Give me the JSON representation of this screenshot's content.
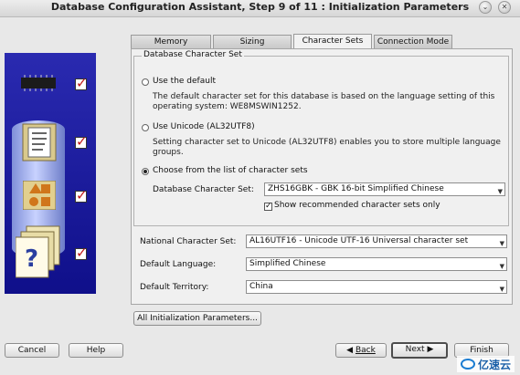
{
  "window": {
    "title": "Database Configuration Assistant, Step 9 of 11 : Initialization Parameters",
    "minimize_icon": "chevron-down-icon",
    "close_icon": "close-icon"
  },
  "tabs": [
    {
      "label": "Memory"
    },
    {
      "label": "Sizing"
    },
    {
      "label": "Character Sets",
      "active": true
    },
    {
      "label": "Connection Mode"
    }
  ],
  "charset_group": {
    "title": "Database Character Set",
    "use_default": {
      "label": "Use the default",
      "description_line1": "The default character set for this database is based on the language setting of this",
      "description_line2": "operating system: WE8MSWIN1252."
    },
    "use_unicode": {
      "label": "Use Unicode (AL32UTF8)",
      "description_line1": "Setting character set to Unicode (AL32UTF8) enables you to store multiple language",
      "description_line2": "groups."
    },
    "choose_list": {
      "label": "Choose from the list of character sets",
      "selected": true
    },
    "db_charset_label": "Database Character Set:",
    "db_charset_value": "ZHS16GBK - GBK 16-bit Simplified Chinese",
    "show_recommended_label": "Show recommended character sets only",
    "show_recommended_checked": true
  },
  "national": {
    "label": "National Character Set:",
    "value": "AL16UTF16 - Unicode UTF-16 Universal character set"
  },
  "language": {
    "label": "Default Language:",
    "value": "Simplified Chinese"
  },
  "territory": {
    "label": "Default Territory:",
    "value": "China"
  },
  "all_params_button": "All Initialization Parameters...",
  "bottom_buttons": {
    "cancel": "Cancel",
    "help": "Help",
    "back": "Back",
    "next": "Next",
    "finish": "Finish"
  },
  "watermark": {
    "text": "亿速云"
  }
}
